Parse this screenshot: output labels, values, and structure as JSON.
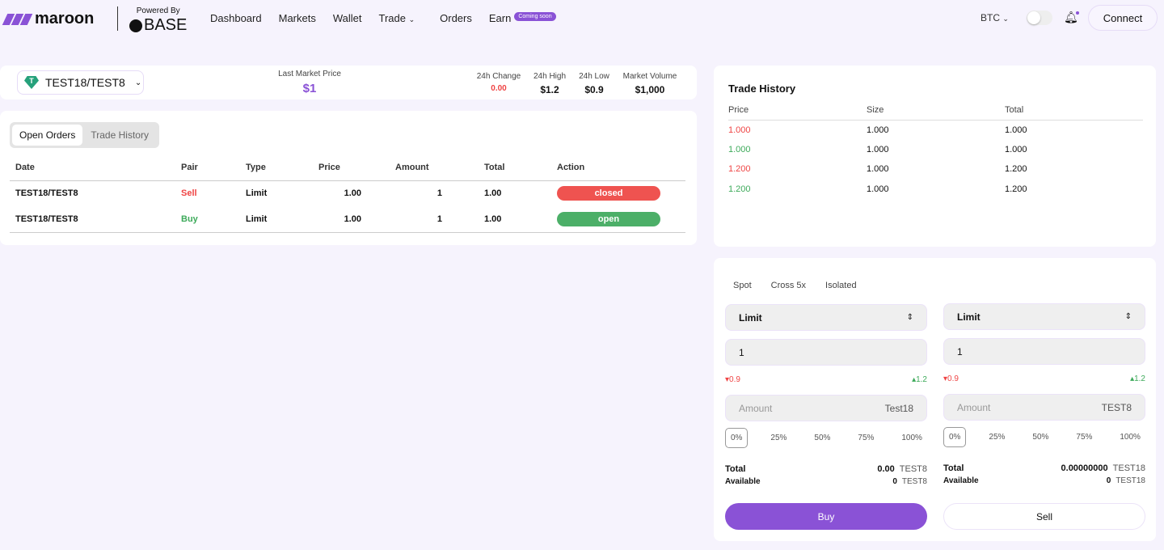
{
  "brand": {
    "name": "maroon",
    "powered_by": "Powered By",
    "base": "BASE"
  },
  "nav": {
    "items": [
      "Dashboard",
      "Markets",
      "Wallet",
      "Trade",
      "Orders",
      "Earn"
    ],
    "earn_badge": "Coming soon",
    "currency": "BTC",
    "connect": "Connect"
  },
  "market": {
    "pair": "TEST18/TEST8",
    "last_price_label": "Last Market Price",
    "last_price": "$1",
    "change_label": "24h Change",
    "change": "0.00",
    "high_label": "24h High",
    "high": "$1.2",
    "low_label": "24h Low",
    "low": "$0.9",
    "volume_label": "Market Volume",
    "volume": "$1,000"
  },
  "orders": {
    "tabs": [
      "Open Orders",
      "Trade History"
    ],
    "columns": [
      "Date",
      "Pair",
      "Type",
      "Price",
      "Amount",
      "Total",
      "Action"
    ],
    "rows": [
      {
        "date": "TEST18/TEST8",
        "pair": "Sell",
        "type": "Limit",
        "price": "1.00",
        "amount": "1",
        "total": "1.00",
        "action": "closed"
      },
      {
        "date": "TEST18/TEST8",
        "pair": "Buy",
        "type": "Limit",
        "price": "1.00",
        "amount": "1",
        "total": "1.00",
        "action": "open"
      }
    ]
  },
  "trade_history": {
    "title": "Trade History",
    "columns": [
      "Price",
      "Size",
      "Total"
    ],
    "rows": [
      {
        "price": "1.000",
        "size": "1.000",
        "total": "1.000",
        "side": "sell"
      },
      {
        "price": "1.000",
        "size": "1.000",
        "total": "1.000",
        "side": "buy"
      },
      {
        "price": "1.200",
        "size": "1.000",
        "total": "1.200",
        "side": "sell"
      },
      {
        "price": "1.200",
        "size": "1.000",
        "total": "1.200",
        "side": "buy"
      }
    ]
  },
  "form": {
    "modes": [
      "Spot",
      "Cross 5x",
      "Isolated"
    ],
    "percents": [
      "0%",
      "25%",
      "50%",
      "75%",
      "100%"
    ],
    "buy": {
      "order_type": "Limit",
      "price": "1",
      "low": "0.9",
      "high": "1.2",
      "amount_placeholder": "Amount",
      "amount_unit": "Test18",
      "total_label": "Total",
      "total": "0.00",
      "total_unit": "TEST8",
      "available_label": "Available",
      "available": "0",
      "available_unit": "TEST8",
      "button": "Buy"
    },
    "sell": {
      "order_type": "Limit",
      "price": "1",
      "low": "0.9",
      "high": "1.2",
      "amount_placeholder": "Amount",
      "amount_unit": "TEST8",
      "total_label": "Total",
      "total": "0.00000000",
      "total_unit": "TEST18",
      "available_label": "Available",
      "available": "0",
      "available_unit": "TEST18",
      "button": "Sell"
    }
  },
  "colors": {
    "accent": "#8a52d6",
    "red": "#ef4444",
    "green": "#3daa5a",
    "closed": "#ef5350",
    "open": "#4caf68"
  }
}
